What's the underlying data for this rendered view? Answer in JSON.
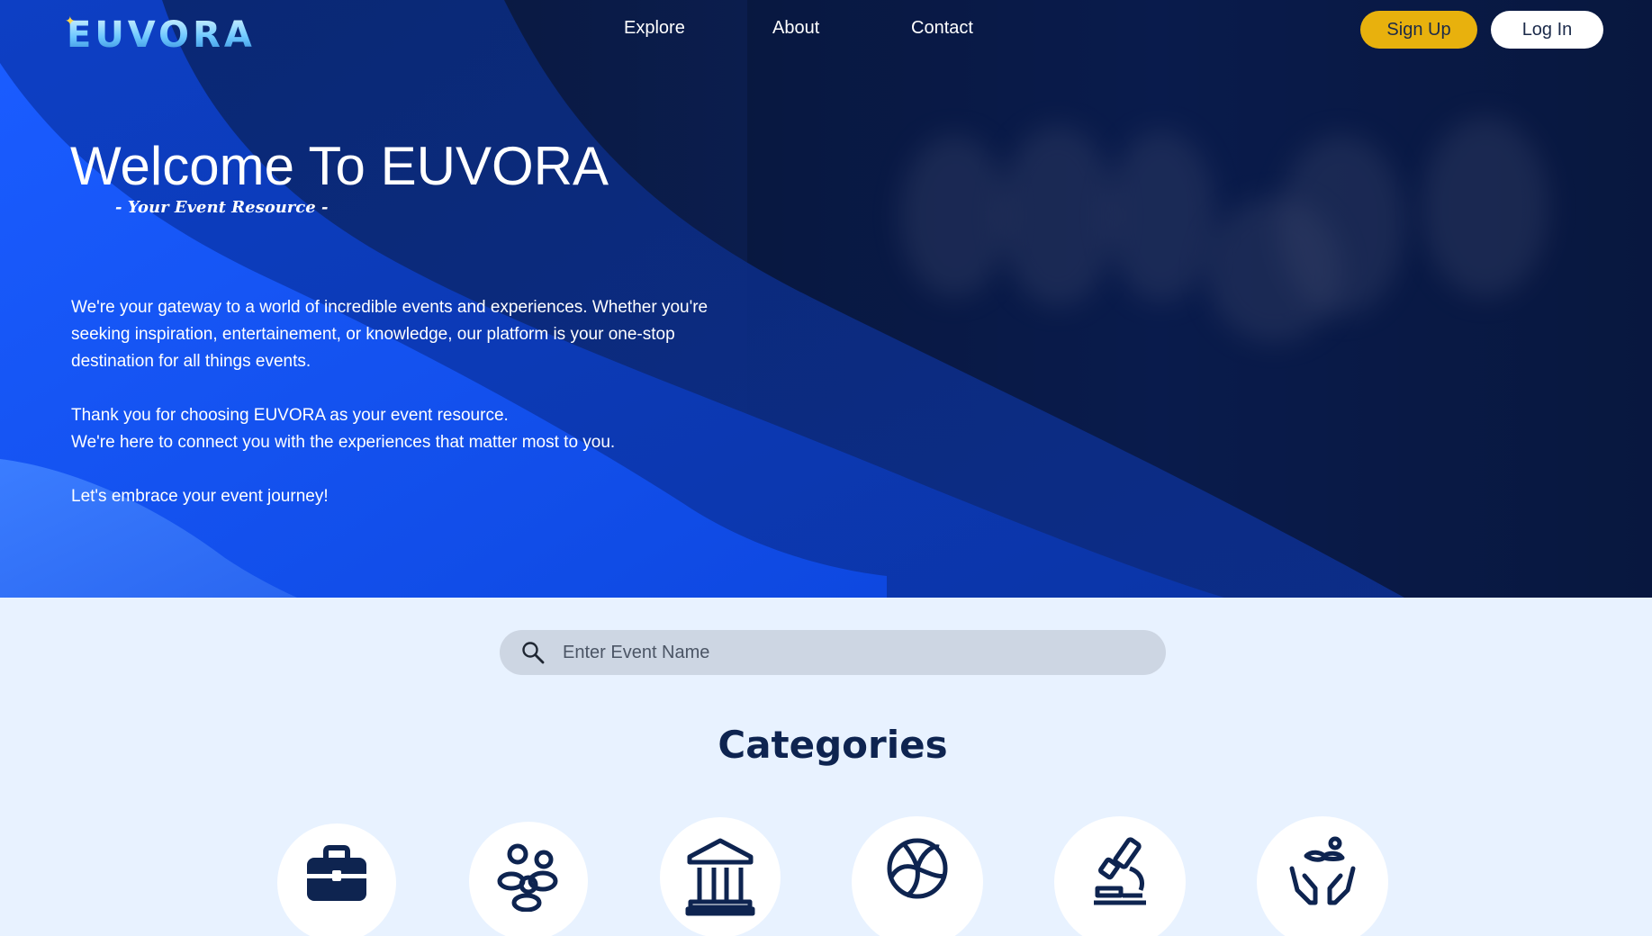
{
  "brand": {
    "logo_text": "EUVORA"
  },
  "nav": {
    "items": [
      {
        "label": "Explore"
      },
      {
        "label": "About"
      },
      {
        "label": "Contact"
      }
    ]
  },
  "auth": {
    "signup_label": "Sign Up",
    "login_label": "Log In"
  },
  "hero": {
    "title": "Welcome To EUVORA",
    "subtitle": "- Your Event Resource -",
    "paragraph_1": "We're your gateway to a world of incredible events and experiences. Whether you're seeking inspiration, entertainement, or knowledge, our platform is your one-stop destination for all things events.",
    "paragraph_2_line_1": "Thank you for choosing EUVORA as your event resource.",
    "paragraph_2_line_2": "We're here to connect you with the experiences that matter most to you.",
    "paragraph_3": "Let's embrace your event journey!"
  },
  "search": {
    "placeholder": "Enter Event Name",
    "icon": "search-icon"
  },
  "categories": {
    "title": "Categories",
    "items": [
      {
        "icon": "briefcase-icon"
      },
      {
        "icon": "community-icon"
      },
      {
        "icon": "museum-icon"
      },
      {
        "icon": "volleyball-icon"
      },
      {
        "icon": "microscope-icon"
      },
      {
        "icon": "charity-hands-icon"
      }
    ]
  },
  "colors": {
    "hero_dark": "#07122e",
    "hero_blue": "#1a5cff",
    "accent_yellow": "#e8b10d",
    "page_bg": "#e8f2ff",
    "navy_text": "#0e2450"
  }
}
